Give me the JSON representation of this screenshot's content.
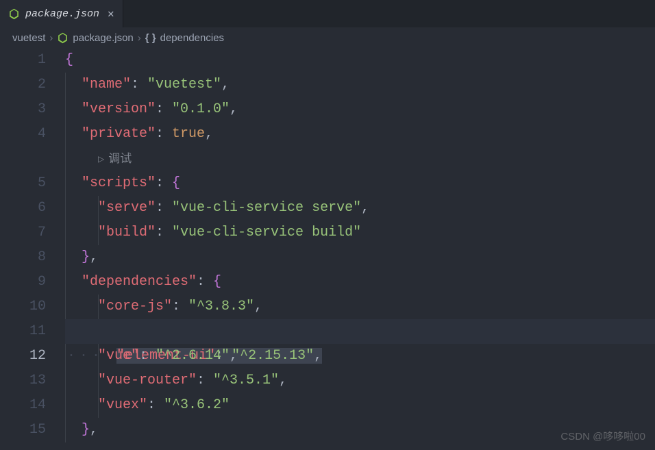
{
  "tab": {
    "filename": "package.json",
    "iconColor": "#8cc84b"
  },
  "breadcrumbs": {
    "folder": "vuetest",
    "file": "package.json",
    "symbol": "dependencies",
    "symbolIcon": "{ }"
  },
  "codelens": {
    "playGlyph": "▷",
    "label": "调试"
  },
  "code": {
    "lines": [
      {
        "num": 1,
        "indent": 0,
        "content": [
          {
            "t": "brace",
            "v": "{"
          }
        ]
      },
      {
        "num": 2,
        "indent": 1,
        "content": [
          {
            "t": "key",
            "v": "\"name\""
          },
          {
            "t": "punc",
            "v": ": "
          },
          {
            "t": "str",
            "v": "\"vuetest\""
          },
          {
            "t": "punc",
            "v": ","
          }
        ]
      },
      {
        "num": 3,
        "indent": 1,
        "content": [
          {
            "t": "key",
            "v": "\"version\""
          },
          {
            "t": "punc",
            "v": ": "
          },
          {
            "t": "str",
            "v": "\"0.1.0\""
          },
          {
            "t": "punc",
            "v": ","
          }
        ]
      },
      {
        "num": 4,
        "indent": 1,
        "content": [
          {
            "t": "key",
            "v": "\"private\""
          },
          {
            "t": "punc",
            "v": ": "
          },
          {
            "t": "bool",
            "v": "true"
          },
          {
            "t": "punc",
            "v": ","
          }
        ],
        "codelensAfter": true
      },
      {
        "num": 5,
        "indent": 1,
        "content": [
          {
            "t": "key",
            "v": "\"scripts\""
          },
          {
            "t": "punc",
            "v": ": "
          },
          {
            "t": "brace",
            "v": "{"
          }
        ]
      },
      {
        "num": 6,
        "indent": 2,
        "content": [
          {
            "t": "key",
            "v": "\"serve\""
          },
          {
            "t": "punc",
            "v": ": "
          },
          {
            "t": "str",
            "v": "\"vue-cli-service serve\""
          },
          {
            "t": "punc",
            "v": ","
          }
        ]
      },
      {
        "num": 7,
        "indent": 2,
        "content": [
          {
            "t": "key",
            "v": "\"build\""
          },
          {
            "t": "punc",
            "v": ": "
          },
          {
            "t": "str",
            "v": "\"vue-cli-service build\""
          }
        ]
      },
      {
        "num": 8,
        "indent": 1,
        "content": [
          {
            "t": "brace",
            "v": "}"
          },
          {
            "t": "punc",
            "v": ","
          }
        ]
      },
      {
        "num": 9,
        "indent": 1,
        "content": [
          {
            "t": "key",
            "v": "\"dependencies\""
          },
          {
            "t": "punc",
            "v": ": "
          },
          {
            "t": "brace",
            "v": "{"
          }
        ]
      },
      {
        "num": 10,
        "indent": 2,
        "content": [
          {
            "t": "key",
            "v": "\"core-js\""
          },
          {
            "t": "punc",
            "v": ": "
          },
          {
            "t": "str",
            "v": "\"^3.8.3\""
          },
          {
            "t": "punc",
            "v": ","
          }
        ]
      },
      {
        "num": 11,
        "indent": 2,
        "highlight": true,
        "wsdots": true,
        "selection": true,
        "content": [
          {
            "t": "key",
            "v": "\"element-ui\""
          },
          {
            "t": "punc",
            "v": ": "
          },
          {
            "t": "str",
            "v": "\"^2.15.13\""
          },
          {
            "t": "punc",
            "v": ","
          }
        ]
      },
      {
        "num": 12,
        "indent": 2,
        "active": true,
        "content": [
          {
            "t": "key",
            "v": "\"vue\""
          },
          {
            "t": "punc",
            "v": ": "
          },
          {
            "t": "str",
            "v": "\"^2.6.14\""
          },
          {
            "t": "punc",
            "v": ","
          }
        ]
      },
      {
        "num": 13,
        "indent": 2,
        "content": [
          {
            "t": "key",
            "v": "\"vue-router\""
          },
          {
            "t": "punc",
            "v": ": "
          },
          {
            "t": "str",
            "v": "\"^3.5.1\""
          },
          {
            "t": "punc",
            "v": ","
          }
        ]
      },
      {
        "num": 14,
        "indent": 2,
        "content": [
          {
            "t": "key",
            "v": "\"vuex\""
          },
          {
            "t": "punc",
            "v": ": "
          },
          {
            "t": "str",
            "v": "\"^3.6.2\""
          }
        ]
      },
      {
        "num": 15,
        "indent": 1,
        "content": [
          {
            "t": "brace",
            "v": "}"
          },
          {
            "t": "punc",
            "v": ","
          }
        ]
      }
    ]
  },
  "watermark": "CSDN @哆哆啦00"
}
